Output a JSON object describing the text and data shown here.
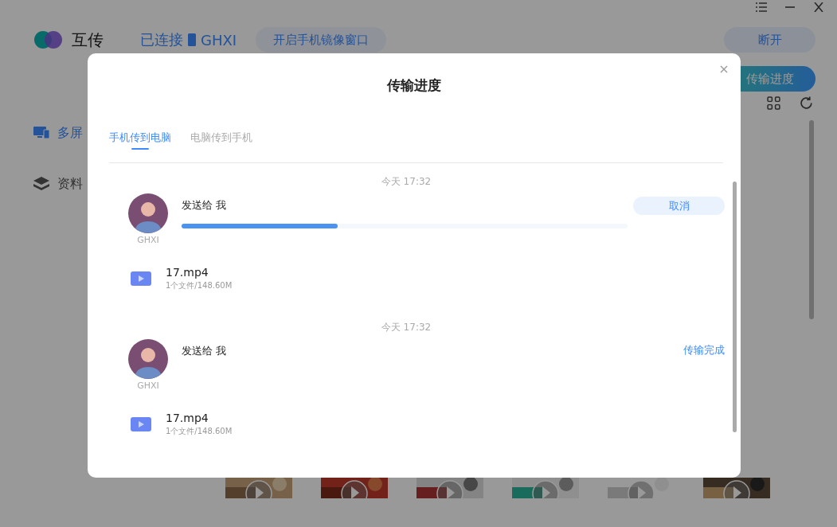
{
  "header": {
    "app_name": "互传",
    "connection": "已连接",
    "device": "GHXI",
    "mirror_button": "开启手机镜像窗口",
    "disconnect_button": "断开",
    "progress_button": "传输进度"
  },
  "sidebar": {
    "items": [
      {
        "label": "多屏",
        "selected": true
      },
      {
        "label": "资料",
        "selected": false
      }
    ]
  },
  "dialog": {
    "title": "传输进度",
    "tabs": [
      {
        "label": "手机传到电脑",
        "selected": true
      },
      {
        "label": "电脑传到手机",
        "selected": false
      }
    ],
    "transfers": [
      {
        "time": "今天 17:32",
        "sender": "GHXI",
        "text": "发送给 我",
        "kind": "progress",
        "level": 0.35,
        "action": "取消",
        "file": {
          "name": "17.mp4",
          "meta": "1个文件/148.60M"
        }
      },
      {
        "time": "今天 17:32",
        "sender": "GHXI",
        "text": "发送给 我",
        "kind": "done",
        "action": "传输完成",
        "file": {
          "name": "17.mp4",
          "meta": "1个文件/148.60M"
        }
      }
    ]
  }
}
